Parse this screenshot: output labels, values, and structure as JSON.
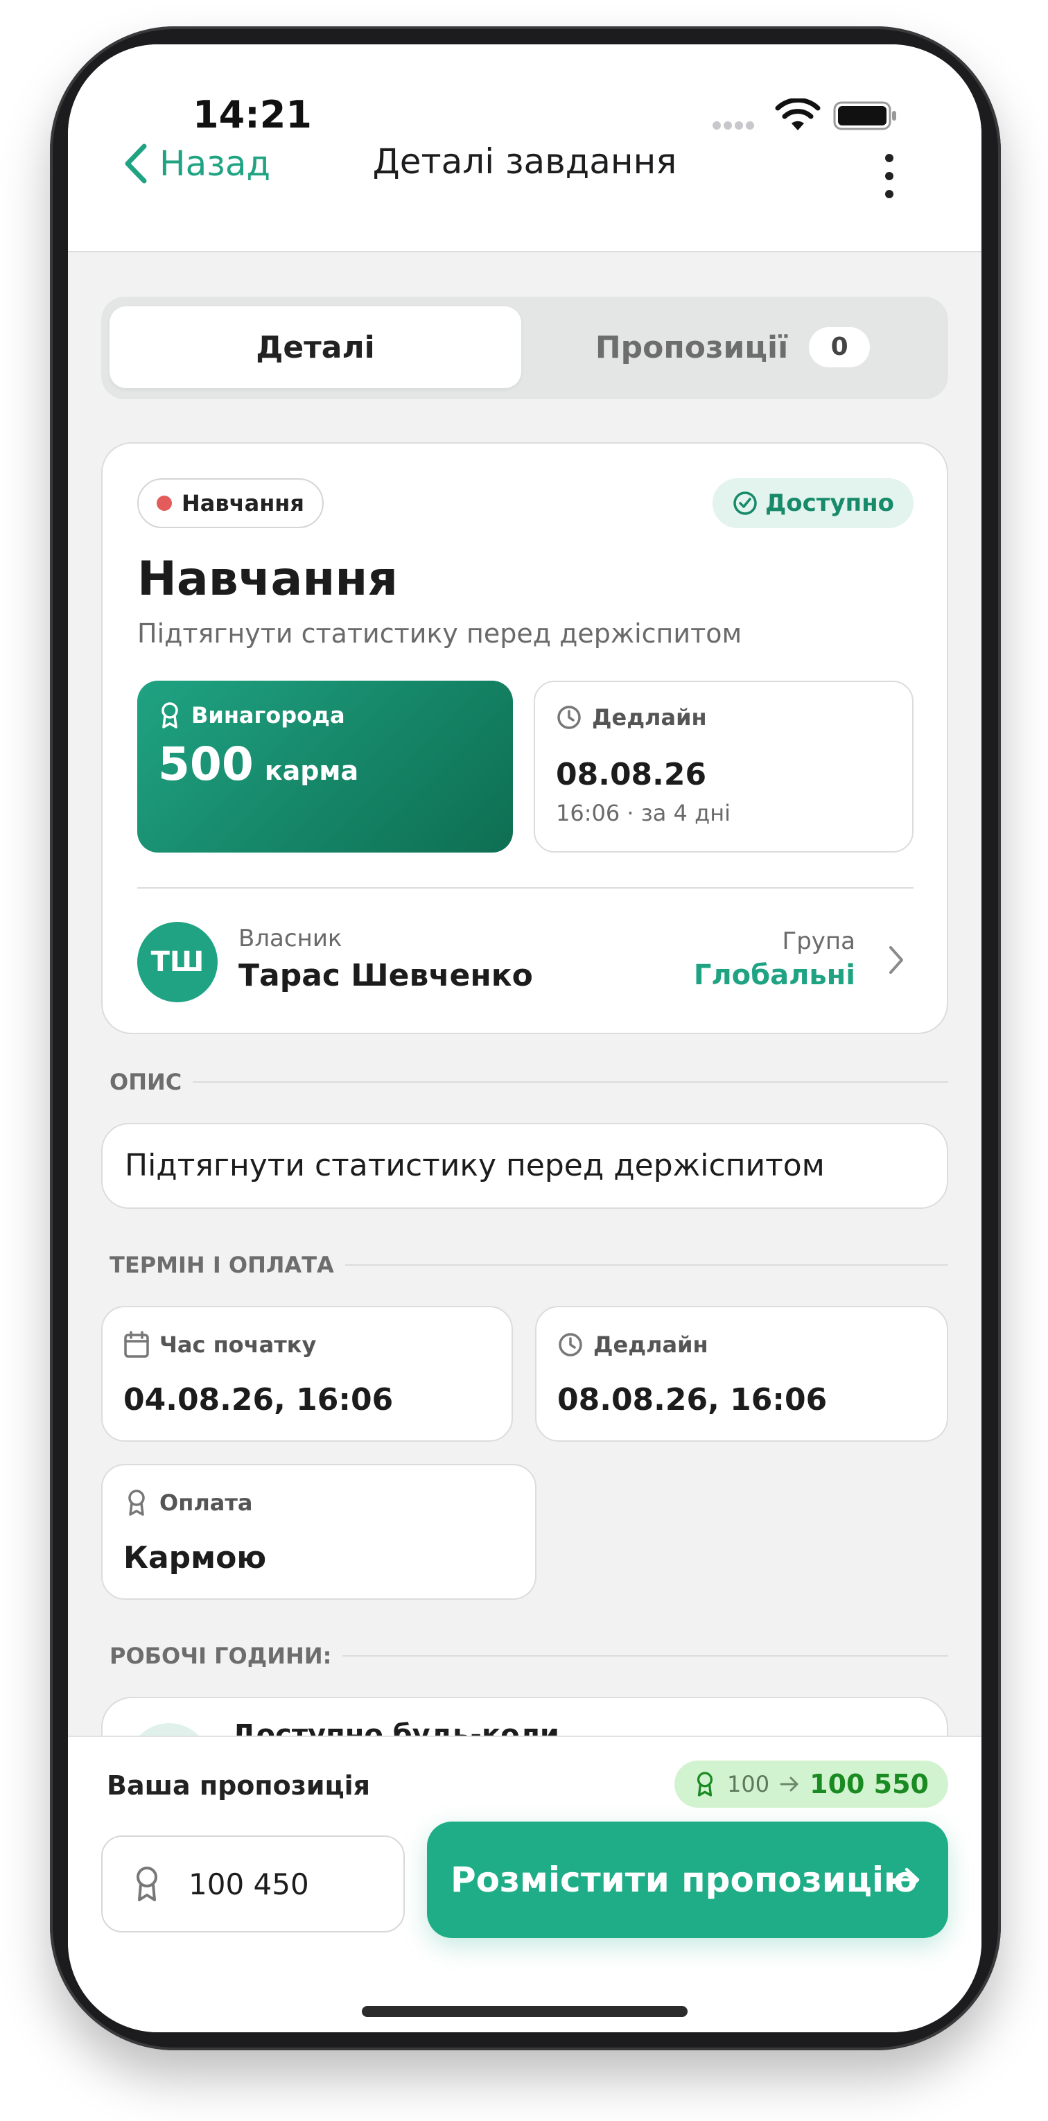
{
  "status_bar": {
    "time": "14:21"
  },
  "nav": {
    "back_label": "Назад",
    "title": "Деталі завдання"
  },
  "tabs": {
    "details": "Деталі",
    "offers": "Пропозиції",
    "offers_count": "0"
  },
  "task": {
    "category": "Навчання",
    "status": "Доступно",
    "title": "Навчання",
    "subtitle": "Підтягнути статистику перед держіспитом",
    "reward_label": "Винагорода",
    "reward_value": "500",
    "reward_unit": "карма",
    "deadline_label": "Дедлайн",
    "deadline_date": "08.08.26",
    "deadline_sub": "16:06 · за 4 дні",
    "owner_label": "Власник",
    "owner_initials": "ТШ",
    "owner_name": "Тарас Шевченко",
    "group_label": "Група",
    "group_name": "Глобальні"
  },
  "description": {
    "heading": "ОПИС",
    "text": "Підтягнути статистику перед держіспитом"
  },
  "term": {
    "heading": "ТЕРМІН І ОПЛАТА",
    "start_label": "Час початку",
    "start_value": "04.08.26, 16:06",
    "deadline_label": "Дедлайн",
    "deadline_value": "08.08.26, 16:06",
    "payment_label": "Оплата",
    "payment_value": "Кармою"
  },
  "hours": {
    "heading": "РОБОЧІ ГОДИНИ:",
    "text": "Доступно будь-коли"
  },
  "offer": {
    "label": "Ваша пропозиція",
    "balance_from": "100",
    "balance_to": "100 550",
    "amount": "100 450",
    "submit_label": "Розмістити пропозицію"
  },
  "colors": {
    "accent": "#1fa382",
    "category_dot": "#e45b5b",
    "balance_bg": "#d2f3cf"
  },
  "icons": [
    "chevron-left-icon",
    "more-vertical-icon",
    "check-circle-icon",
    "award-icon",
    "clock-icon",
    "calendar-icon",
    "chevron-right-icon",
    "arrow-right-icon",
    "wifi-icon",
    "battery-icon"
  ]
}
